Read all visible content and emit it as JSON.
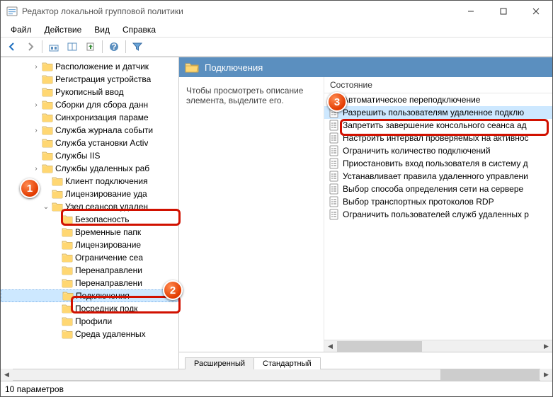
{
  "window": {
    "title": "Редактор локальной групповой политики"
  },
  "menu": {
    "file": "Файл",
    "action": "Действие",
    "view": "Вид",
    "help": "Справка"
  },
  "tree": {
    "items": [
      {
        "ind": 3,
        "exp": ">",
        "label": "Расположение и датчик"
      },
      {
        "ind": 3,
        "exp": "",
        "label": "Регистрация устройства"
      },
      {
        "ind": 3,
        "exp": "",
        "label": "Рукописный ввод"
      },
      {
        "ind": 3,
        "exp": ">",
        "label": "Сборки для сбора данн"
      },
      {
        "ind": 3,
        "exp": "",
        "label": "Синхронизация параме"
      },
      {
        "ind": 3,
        "exp": ">",
        "label": "Служба журнала событи"
      },
      {
        "ind": 3,
        "exp": "",
        "label": "Служба установки Activ"
      },
      {
        "ind": 3,
        "exp": "",
        "label": "Службы IIS"
      },
      {
        "ind": 3,
        "exp": ">",
        "label": "Службы удаленных раб"
      },
      {
        "ind": 4,
        "exp": "",
        "label": "Клиент подключения"
      },
      {
        "ind": 4,
        "exp": "",
        "label": "Лицензирование уда"
      },
      {
        "ind": 4,
        "exp": "v",
        "label": "Узел сеансов удален"
      },
      {
        "ind": 5,
        "exp": "",
        "label": "Безопасность"
      },
      {
        "ind": 5,
        "exp": "",
        "label": "Временные папк"
      },
      {
        "ind": 5,
        "exp": "",
        "label": "Лицензирование"
      },
      {
        "ind": 5,
        "exp": "",
        "label": "Ограничение сеа"
      },
      {
        "ind": 5,
        "exp": "",
        "label": "Перенаправлени"
      },
      {
        "ind": 5,
        "exp": "",
        "label": "Перенаправлени"
      },
      {
        "ind": 5,
        "exp": "",
        "label": "Подключения",
        "sel": true
      },
      {
        "ind": 5,
        "exp": "",
        "label": "Посредник подк"
      },
      {
        "ind": 5,
        "exp": "",
        "label": "Профили"
      },
      {
        "ind": 5,
        "exp": "",
        "label": "Среда удаленных"
      }
    ]
  },
  "right": {
    "title": "Подключения",
    "descr": "Чтобы просмотреть описание элемента, выделите его.",
    "col": "Состояние",
    "rows": [
      "Автоматическое переподключение",
      "Разрешить пользователям удаленное подклю",
      "Запретить завершение консольного сеанса ад",
      "Настроить интервал проверяемых на активнос",
      "Ограничить количество подключений",
      "Приостановить вход пользователя в систему д",
      "Устанавливает правила удаленного управлени",
      "Выбор способа определения сети на сервере",
      "Выбор транспортных протоколов RDP",
      "Ограничить пользователей служб удаленных р"
    ]
  },
  "tabs": {
    "ext": "Расширенный",
    "std": "Стандартный"
  },
  "status": "10 параметров",
  "markers": {
    "m1": "1",
    "m2": "2",
    "m3": "3"
  }
}
